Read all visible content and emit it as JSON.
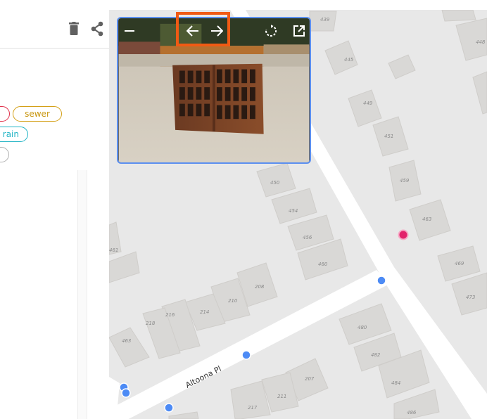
{
  "panel": {
    "tags": [
      {
        "label": "",
        "color": "#e0314b"
      },
      {
        "label": "sewer",
        "color": "#d4a017"
      },
      {
        "label": "rain",
        "color": "#1fb3c4"
      },
      {
        "label": "",
        "color": "#9a9a9a"
      }
    ],
    "icons": [
      "trash-icon",
      "share-icon"
    ]
  },
  "popup": {
    "icons": [
      "minimize-icon",
      "arrow-left-icon",
      "arrow-right-icon",
      "rotate-icon",
      "open-external-icon"
    ]
  },
  "map": {
    "street_label": "Altoona Pl",
    "marker_colors": {
      "blue": "#4d8bf5",
      "pink": "#e2226b"
    },
    "building_numbers": [
      "439",
      "445",
      "448",
      "449",
      "451",
      "450",
      "459",
      "454",
      "463",
      "456",
      "460",
      "469",
      "473",
      "208",
      "210",
      "214",
      "216",
      "218",
      "463",
      "461",
      "480",
      "482",
      "484",
      "486",
      "207",
      "211",
      "217"
    ]
  }
}
